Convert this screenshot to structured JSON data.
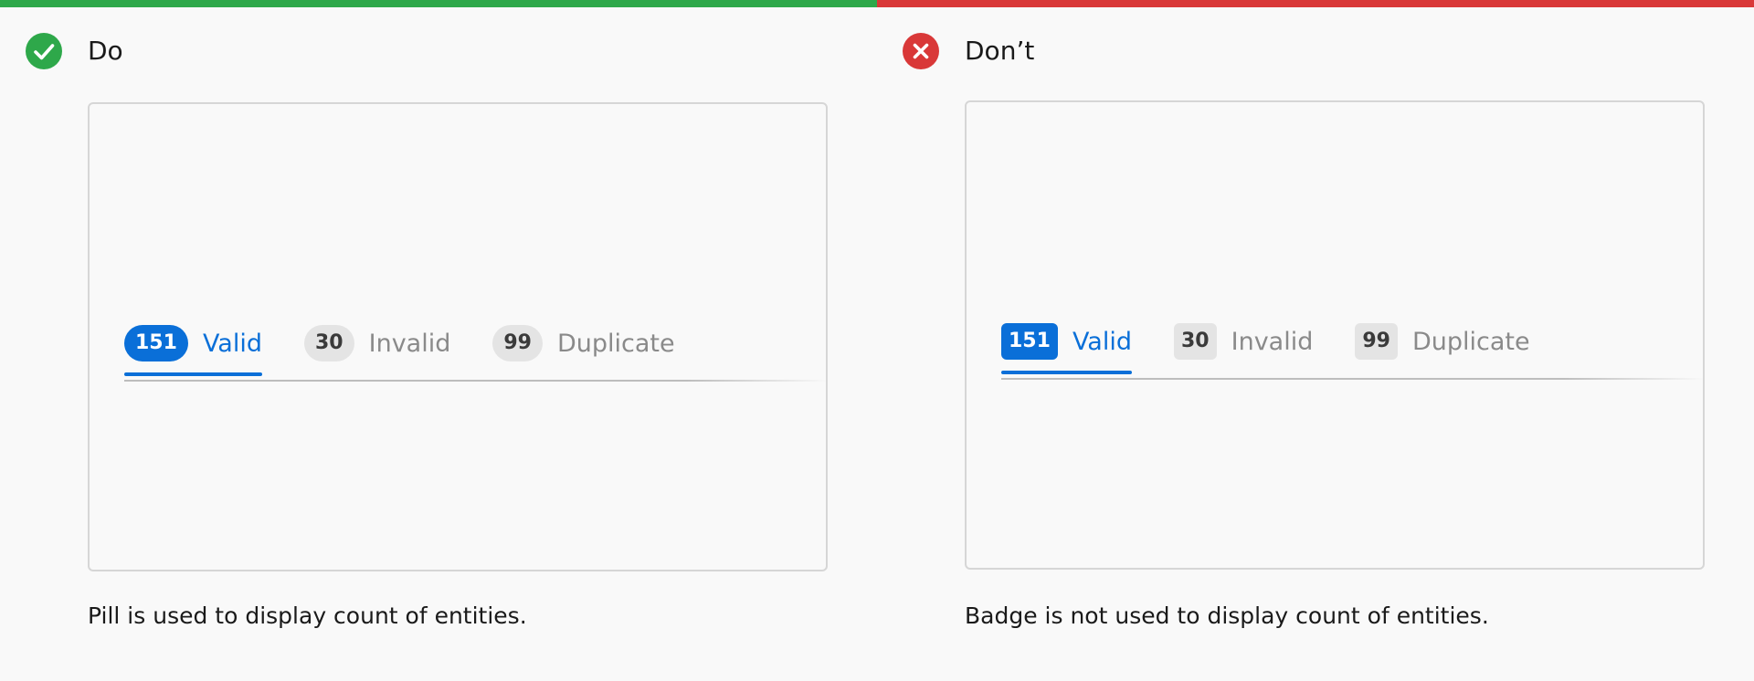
{
  "colors": {
    "do_accent": "#2ea84a",
    "dont_accent": "#d93838",
    "active_blue": "#0a6fd8",
    "inactive_count_bg": "#e4e4e4",
    "inactive_text": "#8a8a8a"
  },
  "do": {
    "icon": "check-circle-icon",
    "heading": "Do",
    "tabs": [
      {
        "count": "151",
        "label": "Valid",
        "active": true
      },
      {
        "count": "30",
        "label": "Invalid",
        "active": false
      },
      {
        "count": "99",
        "label": "Duplicate",
        "active": false
      }
    ],
    "caption": "Pill is used to display count of entities."
  },
  "dont": {
    "icon": "x-circle-icon",
    "heading": "Don’t",
    "tabs": [
      {
        "count": "151",
        "label": "Valid",
        "active": true
      },
      {
        "count": "30",
        "label": "Invalid",
        "active": false
      },
      {
        "count": "99",
        "label": "Duplicate",
        "active": false
      }
    ],
    "caption": "Badge is not used to display count of entities."
  }
}
